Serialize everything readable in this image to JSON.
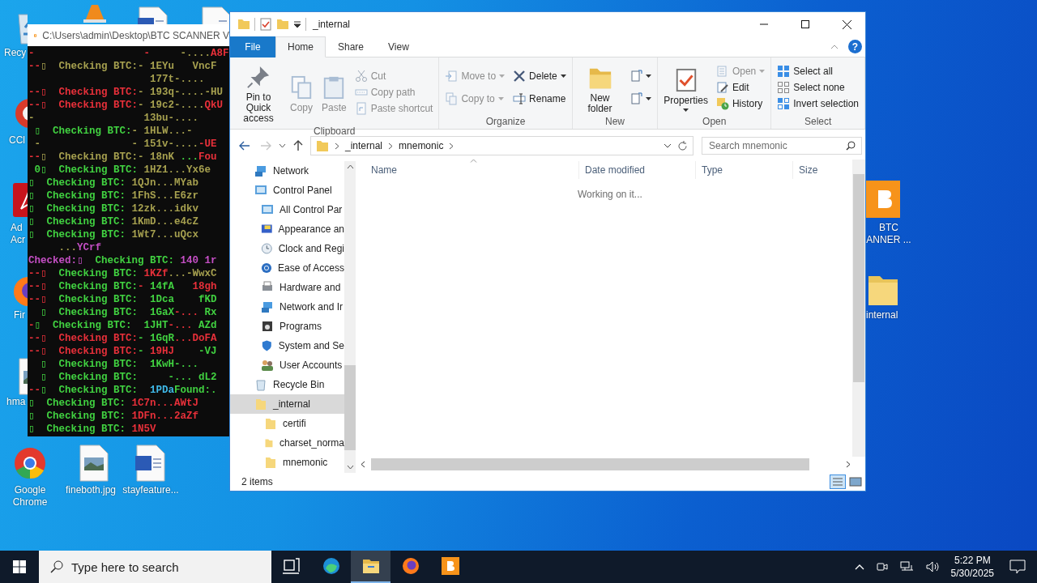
{
  "desktop_icons": [
    {
      "kind": "recycle",
      "label_lines": [
        "Recy"
      ]
    },
    {
      "kind": "vlc"
    },
    {
      "kind": "word"
    },
    {
      "kind": "document"
    },
    {
      "kind": "ccleaner",
      "label_lines": [
        "CCl"
      ]
    },
    {
      "kind": "acrobat",
      "label_lines": [
        "Ad",
        "Acr"
      ]
    },
    {
      "kind": "bitcoin",
      "label_lines": [
        "BTC",
        "ANNER ..."
      ]
    },
    {
      "kind": "firefox",
      "label_lines": [
        "Fir"
      ]
    },
    {
      "kind": "folder",
      "label_lines": [
        "internal"
      ]
    },
    {
      "kind": "image",
      "label_lines": [
        "hma"
      ]
    },
    {
      "kind": "chrome",
      "label_lines": [
        "Google",
        "Chrome"
      ]
    },
    {
      "kind": "image",
      "label_lines": [
        "fineboth.jpg"
      ]
    },
    {
      "kind": "word",
      "label_lines": [
        "stayfeature..."
      ]
    }
  ],
  "console": {
    "title": "C:\\Users\\admin\\Desktop\\BTC SCANNER V",
    "lines": [
      {
        "segments": [
          {
            "text": "-                  -",
            "color": "#e8303a"
          },
          {
            "text": "     -....",
            "color": "#a6a04f"
          },
          {
            "text": "A8F",
            "color": "#e8303a"
          }
        ]
      },
      {
        "segments": [
          {
            "text": "--",
            "color": "#e8303a"
          },
          {
            "text": "▯  Checking BTC:- 1EYu   VncF",
            "color": "#a6a04f"
          }
        ]
      },
      {
        "segments": [
          {
            "text": "                    177t-....",
            "color": "#a6a04f"
          }
        ]
      },
      {
        "segments": [
          {
            "text": "--▯  Checking BTC:",
            "color": "#e8303a"
          },
          {
            "text": "- 193q-....-HU",
            "color": "#a6a04f"
          }
        ]
      },
      {
        "segments": [
          {
            "text": "--▯  Checking BTC:",
            "color": "#e8303a"
          },
          {
            "text": "- 19c2-....",
            "color": "#a6a04f"
          },
          {
            "text": "QkU",
            "color": "#e8303a"
          }
        ]
      },
      {
        "segments": [
          {
            "text": "-                  13bu-....",
            "color": "#a6a04f"
          }
        ]
      },
      {
        "segments": [
          {
            "text": " ▯  Checking BTC:",
            "color": "#41d241"
          },
          {
            "text": "- 1HLW...-",
            "color": "#a6a04f"
          }
        ]
      },
      {
        "segments": [
          {
            "text": " -               - 151v-....",
            "color": "#a6a04f"
          },
          {
            "text": "-UE",
            "color": "#e8303a"
          }
        ]
      },
      {
        "segments": [
          {
            "text": "--",
            "color": "#e8303a"
          },
          {
            "text": "▯  Checking BTC:- 18nK ",
            "color": "#a6a04f"
          },
          {
            "text": "...",
            "color": "#41d241"
          },
          {
            "text": "Fou",
            "color": "#e8303a"
          }
        ]
      },
      {
        "segments": [
          {
            "text": " 0▯  Checking BTC: ",
            "color": "#41d241"
          },
          {
            "text": "1HZ1...Yx6e",
            "color": "#a6a04f"
          }
        ]
      },
      {
        "segments": [
          {
            "text": "▯  Checking BTC: ",
            "color": "#41d241"
          },
          {
            "text": "1QJn...MYab",
            "color": "#a6a04f"
          }
        ]
      },
      {
        "segments": [
          {
            "text": "▯  Checking BTC: ",
            "color": "#41d241"
          },
          {
            "text": "1FhS...E6zr",
            "color": "#a6a04f"
          }
        ]
      },
      {
        "segments": [
          {
            "text": "▯  Checking BTC: ",
            "color": "#41d241"
          },
          {
            "text": "12zk...idkv",
            "color": "#a6a04f"
          }
        ]
      },
      {
        "segments": [
          {
            "text": "▯  Checking BTC: ",
            "color": "#41d241"
          },
          {
            "text": "1KmD...e4cZ",
            "color": "#a6a04f"
          }
        ]
      },
      {
        "segments": [
          {
            "text": "▯  Checking BTC: ",
            "color": "#41d241"
          },
          {
            "text": "1Wt7...uQcx",
            "color": "#a6a04f"
          }
        ]
      },
      {
        "segments": [
          {
            "text": "     ...",
            "color": "#a6a04f"
          },
          {
            "text": "YCrf",
            "color": "#c54fc5"
          }
        ]
      },
      {
        "segments": [
          {
            "text": "Checked:▯",
            "color": "#c54fc5"
          },
          {
            "text": "  Checking BTC: ",
            "color": "#41d241"
          },
          {
            "text": "140 1r",
            "color": "#c54fc5"
          }
        ]
      },
      {
        "segments": [
          {
            "text": "--▯",
            "color": "#e8303a"
          },
          {
            "text": "  Checking BTC: ",
            "color": "#41d241"
          },
          {
            "text": "1KZf",
            "color": "#e8303a"
          },
          {
            "text": "...-WwxC",
            "color": "#a6a04f"
          }
        ]
      },
      {
        "segments": [
          {
            "text": "--▯",
            "color": "#e8303a"
          },
          {
            "text": "  Checking BTC:",
            "color": "#41d241"
          },
          {
            "text": "- ",
            "color": "#e8303a"
          },
          {
            "text": "14fA   ",
            "color": "#41d241"
          },
          {
            "text": "18gh",
            "color": "#e8303a"
          }
        ]
      },
      {
        "segments": [
          {
            "text": "--▯",
            "color": "#e8303a"
          },
          {
            "text": "  Checking BTC:  1Dca    fKD",
            "color": "#41d241"
          }
        ]
      },
      {
        "segments": [
          {
            "text": "  ▯  Checking BTC:  1GaX",
            "color": "#41d241"
          },
          {
            "text": "-...",
            "color": "#e8303a"
          },
          {
            "text": " Rx",
            "color": "#41d241"
          }
        ]
      },
      {
        "segments": [
          {
            "text": "-",
            "color": "#e8303a"
          },
          {
            "text": "▯  Checking BTC:  1JHT",
            "color": "#41d241"
          },
          {
            "text": "-...",
            "color": "#e8303a"
          },
          {
            "text": " AZd",
            "color": "#41d241"
          }
        ]
      },
      {
        "segments": [
          {
            "text": "--▯  Checking BTC:",
            "color": "#e8303a"
          },
          {
            "text": "- 1GqR",
            "color": "#41d241"
          },
          {
            "text": "...DoFA",
            "color": "#e8303a"
          }
        ]
      },
      {
        "segments": [
          {
            "text": "--▯  Checking BTC:",
            "color": "#e8303a"
          },
          {
            "text": "- ",
            "color": "#41d241"
          },
          {
            "text": "19HJ",
            "color": "#e8303a"
          },
          {
            "text": "    -VJ",
            "color": "#41d241"
          }
        ]
      },
      {
        "segments": [
          {
            "text": "  ▯  Checking BTC:  1KwH-...",
            "color": "#41d241"
          }
        ]
      },
      {
        "segments": [
          {
            "text": "  ▯  Checking BTC:     -... dL2",
            "color": "#41d241"
          }
        ]
      },
      {
        "segments": [
          {
            "text": "--",
            "color": "#e8303a"
          },
          {
            "text": "▯  Checking BTC:  ",
            "color": "#41d241"
          },
          {
            "text": "1PDa",
            "color": "#3fb9e8"
          },
          {
            "text": "Found:.",
            "color": "#41d241"
          }
        ]
      },
      {
        "segments": [
          {
            "text": "▯  Checking BTC: ",
            "color": "#41d241"
          },
          {
            "text": "1C7n...AWtJ",
            "color": "#e8303a"
          }
        ]
      },
      {
        "segments": [
          {
            "text": "▯  Checking BTC: ",
            "color": "#41d241"
          },
          {
            "text": "1DFn...2aZf",
            "color": "#e8303a"
          }
        ]
      },
      {
        "segments": [
          {
            "text": "▯  Checking BTC: ",
            "color": "#41d241"
          },
          {
            "text": "1N5V",
            "color": "#e8303a"
          }
        ]
      }
    ]
  },
  "explorer": {
    "title": "_internal",
    "tabs": [
      {
        "label": "File",
        "kind": "file",
        "selected": false
      },
      {
        "label": "Home",
        "kind": "tab",
        "selected": true
      },
      {
        "label": "Share",
        "kind": "tab",
        "selected": false
      },
      {
        "label": "View",
        "kind": "tab",
        "selected": false
      }
    ],
    "help": "?",
    "ribbon": [
      {
        "label": "Clipboard",
        "columns": [
          [
            {
              "label": "Pin to Quick access",
              "kind": "large",
              "disabled": false,
              "menu": false
            }
          ],
          [
            {
              "label": "Copy",
              "kind": "large",
              "disabled": true,
              "menu": false
            }
          ],
          [
            {
              "label": "Paste",
              "kind": "large",
              "disabled": true,
              "menu": false
            }
          ],
          [
            {
              "label": "Cut",
              "kind": "small",
              "disabled": true,
              "menu": false
            },
            {
              "label": "Copy path",
              "kind": "small",
              "disabled": true,
              "menu": false
            },
            {
              "label": "Paste shortcut",
              "kind": "small",
              "disabled": true,
              "menu": false
            }
          ]
        ]
      },
      {
        "label": "Organize",
        "columns": [
          [
            {
              "label": "Move to",
              "kind": "small",
              "disabled": true,
              "menu": true
            },
            {
              "label": "Copy to",
              "kind": "small",
              "disabled": true,
              "menu": true
            }
          ],
          [
            {
              "label": "Delete",
              "kind": "small",
              "disabled": false,
              "menu": true
            },
            {
              "label": "Rename",
              "kind": "small",
              "disabled": false,
              "menu": false
            }
          ]
        ]
      },
      {
        "label": "New",
        "columns": [
          [
            {
              "label": "New folder",
              "kind": "large",
              "disabled": false,
              "menu": false
            }
          ],
          [
            {
              "kind": "icon",
              "disabled": false,
              "menu": true
            },
            {
              "kind": "icon",
              "disabled": false,
              "menu": true
            }
          ]
        ]
      },
      {
        "label": "Open",
        "columns": [
          [
            {
              "label": "Properties",
              "kind": "large",
              "disabled": false,
              "menu": true
            }
          ],
          [
            {
              "label": "Open",
              "kind": "small",
              "disabled": true,
              "menu": true
            },
            {
              "label": "Edit",
              "kind": "small",
              "disabled": false,
              "menu": false
            },
            {
              "label": "History",
              "kind": "small",
              "disabled": false,
              "menu": false
            }
          ]
        ]
      },
      {
        "label": "Select",
        "columns": [
          [
            {
              "label": "Select all",
              "kind": "small",
              "disabled": false,
              "menu": false
            },
            {
              "label": "Select none",
              "kind": "small",
              "disabled": false,
              "menu": false
            },
            {
              "label": "Invert selection",
              "kind": "small",
              "disabled": false,
              "menu": false
            }
          ]
        ]
      }
    ],
    "address": {
      "forward_disabled": true,
      "crumbs": [
        "_internal",
        "mnemonic"
      ],
      "search": {
        "placeholder": "Search mnemonic"
      }
    },
    "nav": [
      {
        "label": "Network",
        "kind": "network",
        "selected": false
      },
      {
        "label": "Control Panel",
        "kind": "panel",
        "selected": false,
        "children": [
          {
            "label": "All Control Par",
            "kind": "panel",
            "selected": false
          },
          {
            "label": "Appearance an",
            "kind": "appearance",
            "selected": false
          },
          {
            "label": "Clock and Regi",
            "kind": "clock",
            "selected": false
          },
          {
            "label": "Ease of Access",
            "kind": "ease",
            "selected": false
          },
          {
            "label": "Hardware and",
            "kind": "printer",
            "selected": false
          },
          {
            "label": "Network and Ir",
            "kind": "network",
            "selected": false
          },
          {
            "label": "Programs",
            "kind": "programs",
            "selected": false
          },
          {
            "label": "System and Se",
            "kind": "shield",
            "selected": false
          },
          {
            "label": "User Accounts",
            "kind": "users",
            "selected": false
          }
        ]
      },
      {
        "label": "Recycle Bin",
        "kind": "recycle",
        "selected": false
      },
      {
        "label": "_internal",
        "kind": "folder",
        "selected": true,
        "children": [
          {
            "label": "certifi",
            "kind": "folder",
            "selected": false
          },
          {
            "label": "charset_norma",
            "kind": "folder",
            "selected": false
          },
          {
            "label": "mnemonic",
            "kind": "folder",
            "selected": false
          }
        ]
      }
    ],
    "columns": [
      "Name",
      "Date modified",
      "Type",
      "Size"
    ],
    "message": "Working on it...",
    "status": "2 items"
  },
  "taskbar": {
    "search_placeholder": "Type here to search",
    "apps": [
      {
        "kind": "taskview",
        "selected": false
      },
      {
        "kind": "edge",
        "selected": false
      },
      {
        "kind": "explorer",
        "selected": true
      },
      {
        "kind": "firefox",
        "selected": false
      },
      {
        "kind": "bitcoin",
        "selected": false
      }
    ],
    "time": "5:22 PM",
    "date": "5/30/2025"
  }
}
